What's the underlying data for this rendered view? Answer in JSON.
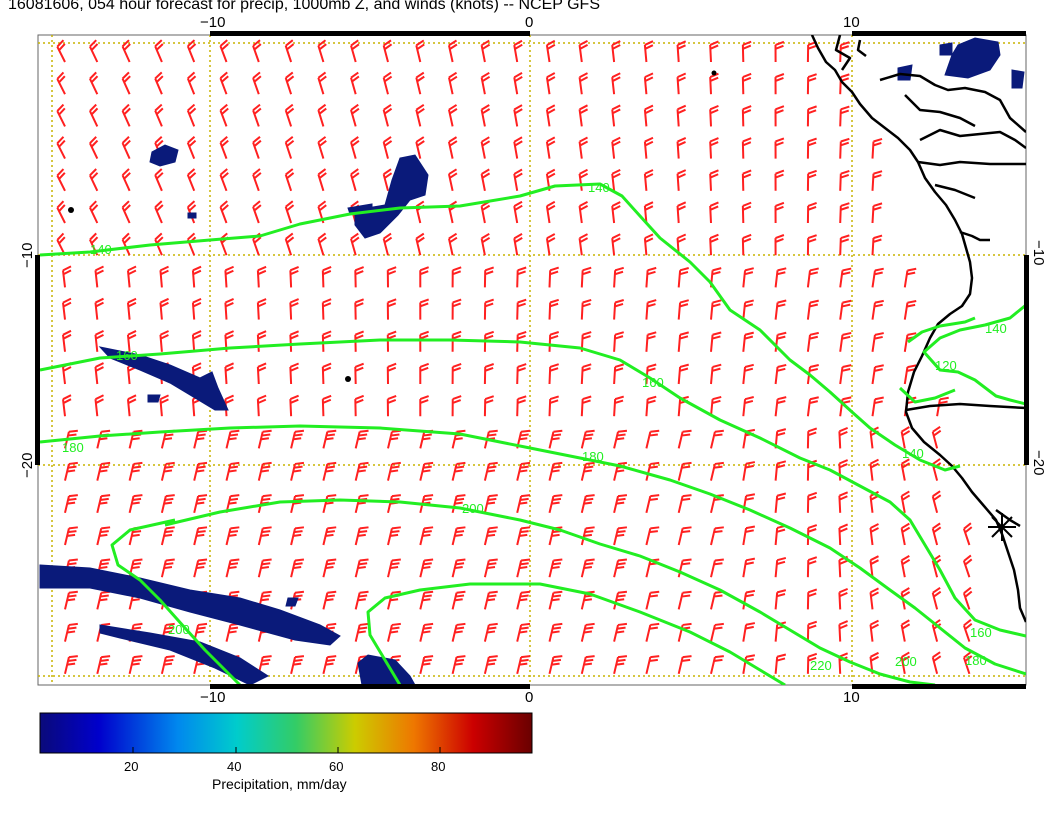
{
  "title": "16081606, 054 hour forecast for precip, 1000mb Z, and winds (knots) -- NCEP GFS",
  "colors": {
    "contour": "#22ee22",
    "barb": "#ff2020",
    "precip": "#0a1a7a",
    "coast": "#000000",
    "grid": "#c8b400"
  },
  "axes": {
    "lon_ticks_top": [
      "−10",
      "0",
      "10"
    ],
    "lon_ticks_bottom": [
      "−10",
      "0",
      "10"
    ],
    "lat_ticks_left": [
      "−10",
      "−20"
    ],
    "lat_ticks_right": [
      "−10",
      "−20"
    ]
  },
  "contour_labels": [
    "140",
    "140",
    "160",
    "160",
    "180",
    "180",
    "140",
    "200",
    "200",
    "220",
    "160",
    "180",
    "140",
    "120",
    "200"
  ],
  "colorbar": {
    "label": "Precipitation, mm/day",
    "ticks": [
      "20",
      "40",
      "60",
      "80"
    ]
  }
}
